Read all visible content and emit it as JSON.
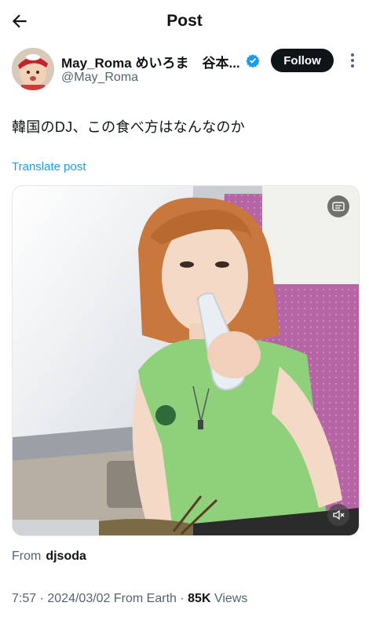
{
  "header": {
    "title": "Post",
    "back_icon": "arrow-left-icon"
  },
  "author": {
    "display_name": "May_Roma めいろま　谷本...",
    "handle": "@May_Roma",
    "verified_color": "#1d9bf0",
    "follow_label": "Follow"
  },
  "post": {
    "text": "韓国のDJ、この食べ方はなんなのか",
    "translate_label": "Translate post"
  },
  "media": {
    "top_right_icon": "captions-icon",
    "bottom_right_icon": "mute-icon"
  },
  "from": {
    "label": "From",
    "source": "djsoda"
  },
  "meta": {
    "time": "7:57",
    "date": "2024/03/02",
    "origin": "From Earth",
    "views_count": "85K",
    "views_label": "Views"
  },
  "colors": {
    "accent": "#1d9bf0",
    "text": "#0f1419",
    "muted": "#536471"
  }
}
